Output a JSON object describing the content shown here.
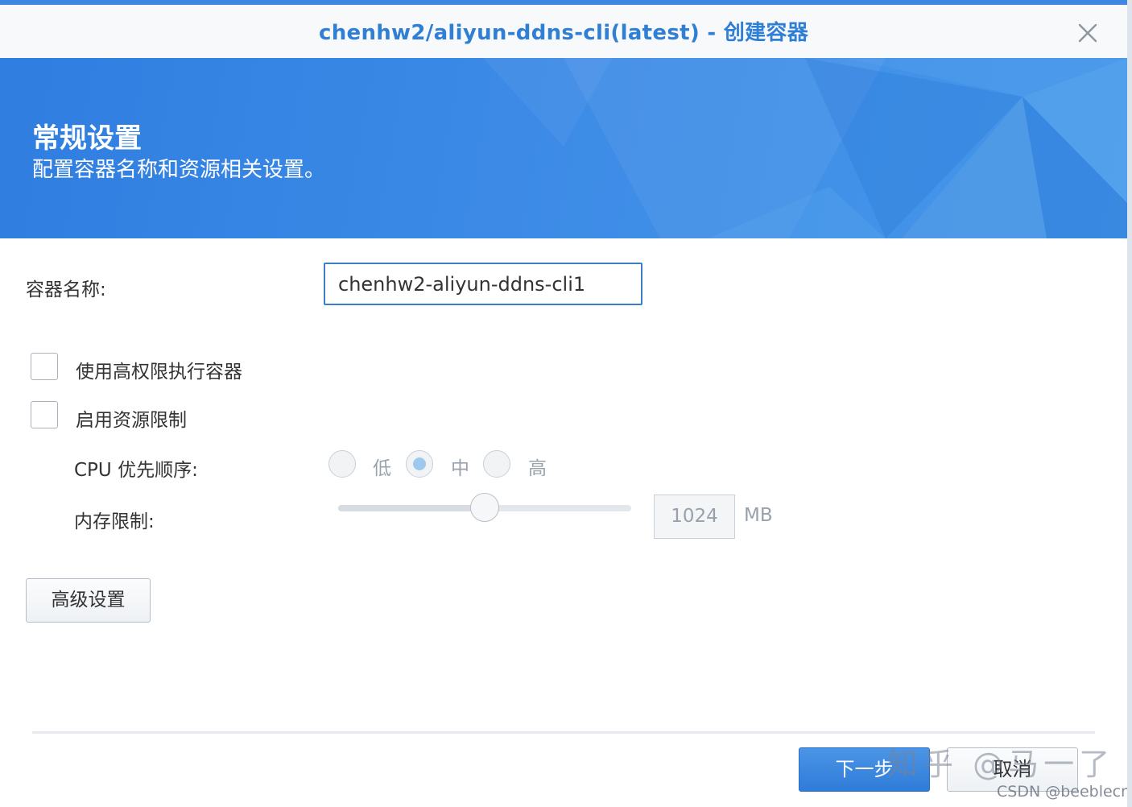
{
  "window": {
    "title": "chenhw2/aliyun-ddns-cli(latest) - 创建容器",
    "close_icon": "close-icon"
  },
  "banner": {
    "title": "常规设置",
    "subtitle": "配置容器名称和资源相关设置。"
  },
  "form": {
    "container_name_label": "容器名称:",
    "container_name_value": "chenhw2-aliyun-ddns-cli1",
    "privileged_label": "使用高权限执行容器",
    "privileged_checked": false,
    "resource_limit_label": "启用资源限制",
    "resource_limit_checked": false,
    "cpu_priority_label": "CPU 优先顺序:",
    "cpu_priority_options": [
      "低",
      "中",
      "高"
    ],
    "cpu_priority_selected": "中",
    "memory_limit_label": "内存限制:",
    "memory_limit_value": "1024",
    "memory_limit_unit": "MB",
    "memory_slider_fraction": 0.5,
    "advanced_button": "高级设置"
  },
  "footer": {
    "next_button": "下一步",
    "cancel_button": "取消"
  },
  "watermarks": {
    "zhihu": "知乎 @马一了",
    "csdn": "CSDN @beeblecn"
  },
  "colors": {
    "accent": "#2f7fd5",
    "banner": "#3c8ae6",
    "primary_button": "#2f7cd9"
  }
}
